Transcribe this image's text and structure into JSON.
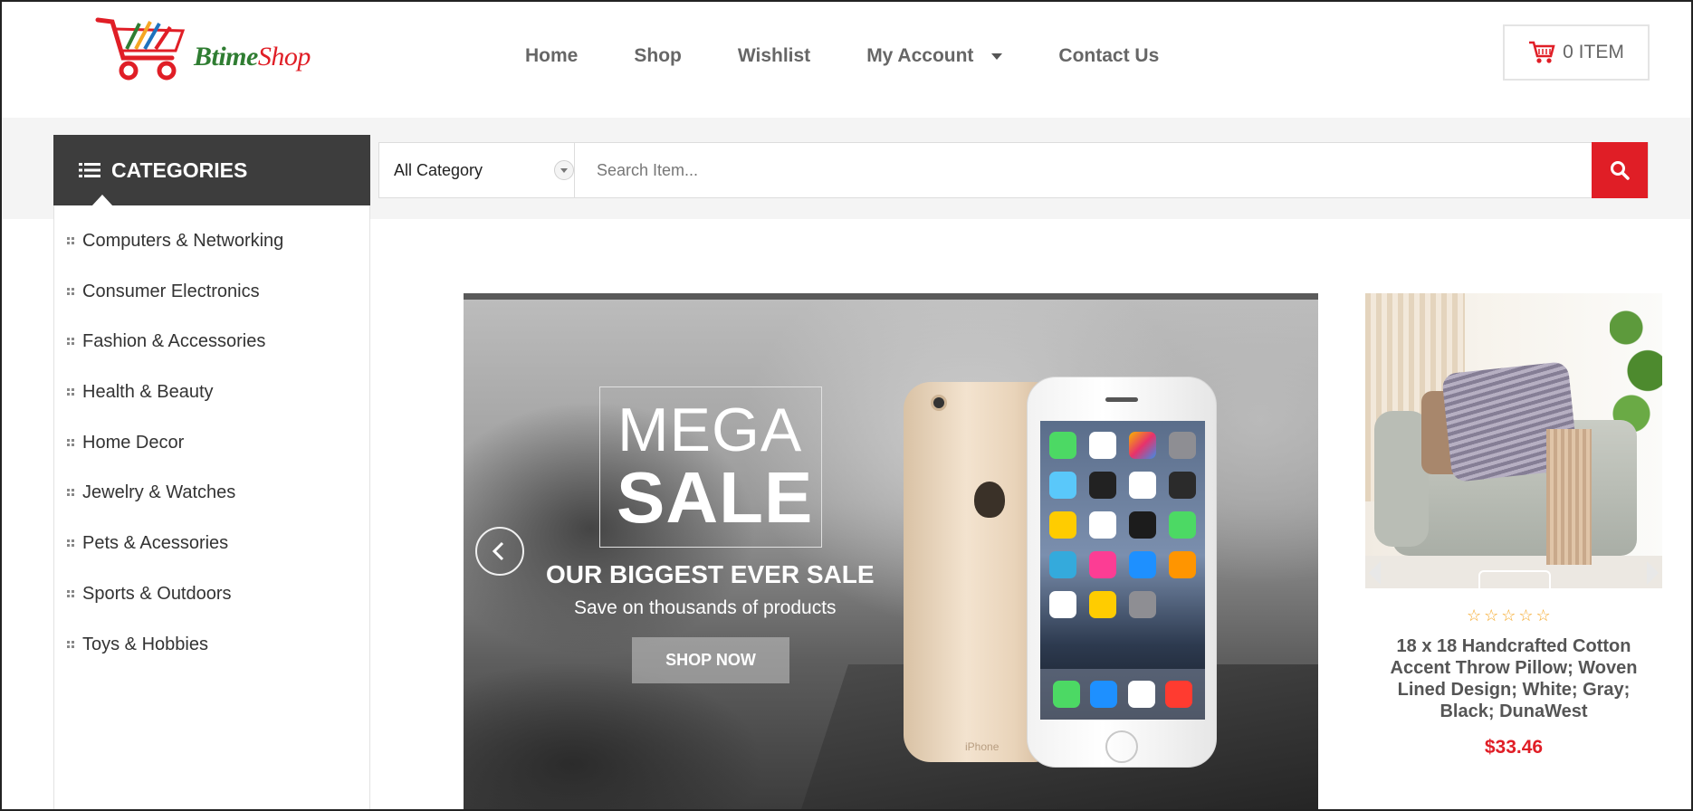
{
  "logo": {
    "part1": "Btime",
    "part2": "Shop"
  },
  "nav": {
    "items": [
      {
        "label": "Home"
      },
      {
        "label": "Shop"
      },
      {
        "label": "Wishlist"
      },
      {
        "label": "My Account"
      },
      {
        "label": "Contact Us"
      }
    ]
  },
  "cart": {
    "label": "0 ITEM",
    "icon": "cart-icon"
  },
  "categories": {
    "title": "CATEGORIES",
    "items": [
      "Computers & Networking",
      "Consumer Electronics",
      "Fashion & Accessories",
      "Health & Beauty",
      "Home Decor",
      "Jewelry & Watches",
      "Pets & Acessories",
      "Sports & Outdoors",
      "Toys & Hobbies"
    ]
  },
  "search": {
    "category": "All Category",
    "placeholder": "Search Item...",
    "icon": "search-icon"
  },
  "banner": {
    "line1": "MEGA",
    "line2": "SALE",
    "tagline": "OUR BIGGEST EVER SALE",
    "subtagline": "Save on thousands of products",
    "cta": "SHOP NOW",
    "phone_brand": "iPhone"
  },
  "product": {
    "rating": 0,
    "stars": "☆☆☆☆☆",
    "title": "18 x 18 Handcrafted Cotton Accent Throw Pillow; Woven Lined Design; White; Gray; Black; DunaWest",
    "price": "$33.46"
  },
  "colors": {
    "accent": "#e01e26",
    "category_header": "#3d3d3d",
    "star": "#f5a623"
  }
}
